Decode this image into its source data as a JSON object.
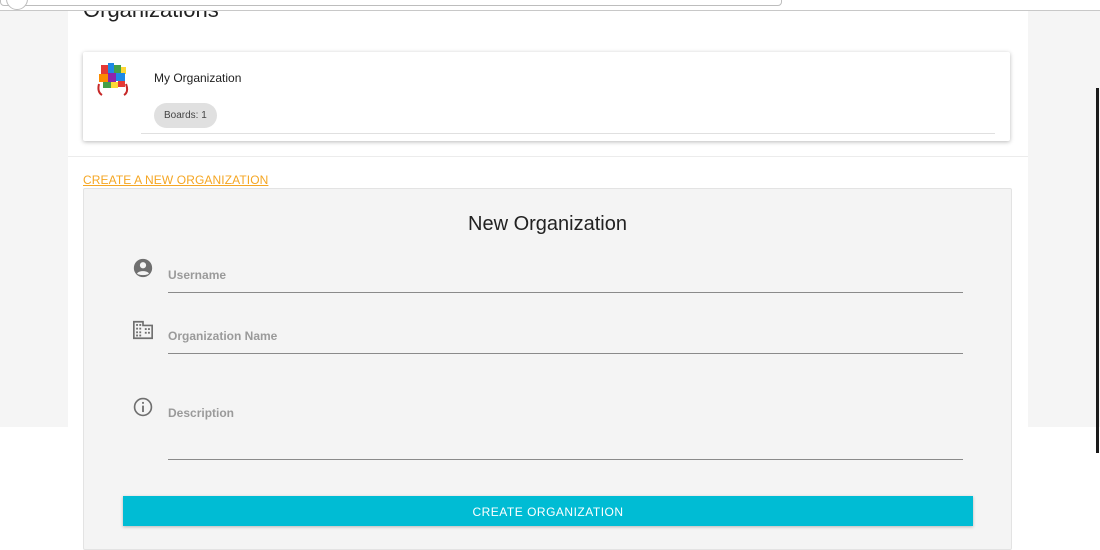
{
  "page": {
    "title": "Organizations"
  },
  "organizations": [
    {
      "name": "My Organization",
      "boards_label": "Boards: 1"
    }
  ],
  "create_link": "CREATE A NEW ORGANIZATION",
  "form": {
    "title": "New Organization",
    "fields": [
      {
        "icon": "account-circle-icon",
        "label": "Username"
      },
      {
        "icon": "business-icon",
        "label": "Organization Name"
      },
      {
        "icon": "info-icon",
        "label": "Description"
      }
    ],
    "submit_label": "CREATE ORGANIZATION"
  },
  "colors": {
    "accent_link": "#f5a623",
    "primary_button": "#00bcd4",
    "panel_bg": "#f4f4f4"
  }
}
